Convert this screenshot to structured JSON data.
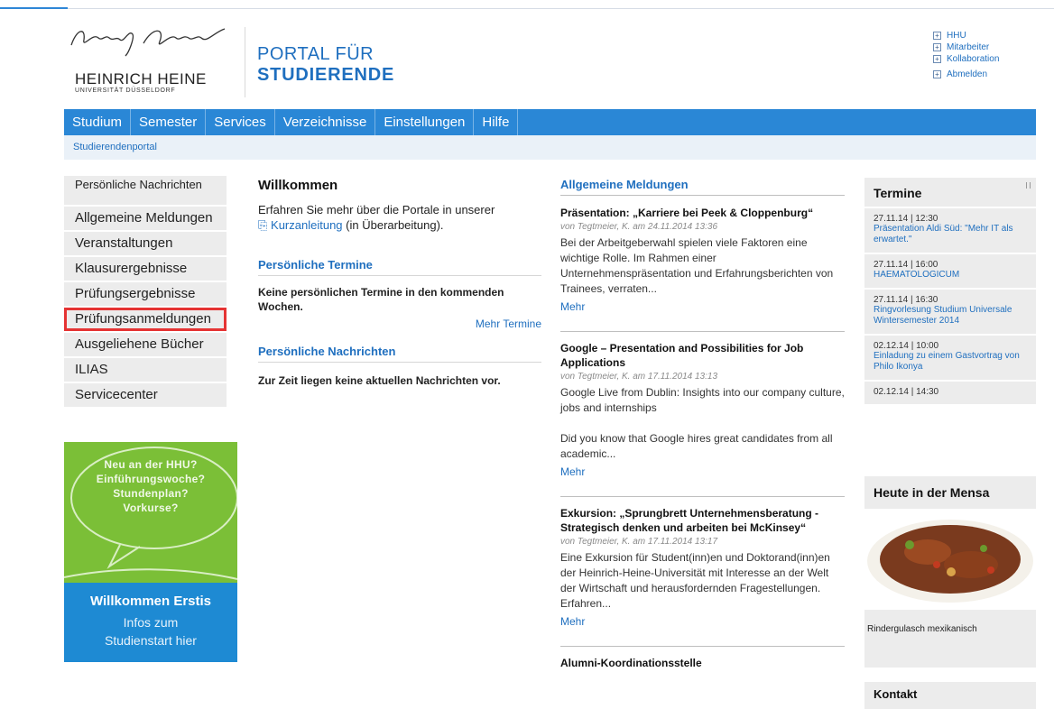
{
  "header": {
    "logo_name": "HEINRICH HEINE",
    "logo_sub": "UNIVERSITÄT DÜSSELDORF",
    "portal_line1": "PORTAL FÜR",
    "portal_line2": "STUDIERENDE",
    "top_links": [
      "HHU",
      "Mitarbeiter",
      "Kollaboration",
      "Abmelden"
    ]
  },
  "nav": [
    "Studium",
    "Semester",
    "Services",
    "Verzeichnisse",
    "Einstellungen",
    "Hilfe"
  ],
  "breadcrumb": "Studierendenportal",
  "sidebar": {
    "items": [
      "Persönliche Nachrichten",
      "Allgemeine Meldungen",
      "Veranstaltungen",
      "Klausurergebnisse",
      "Prüfungsergebnisse",
      "Prüfungsanmeldungen",
      "Ausgeliehene Bücher",
      "ILIAS",
      "Servicecenter"
    ],
    "active_index": 5
  },
  "banner": {
    "lines": [
      "Neu an der HHU?",
      "Einführungswoche?",
      "Stundenplan?",
      "Vorkurse?"
    ],
    "title": "Willkommen Erstis",
    "sub1": "Infos zum",
    "sub2": "Studienstart hier",
    "green": "#7bbf37",
    "blue": "#1e8ad3"
  },
  "welcome": {
    "title": "Willkommen",
    "text_pre": "Erfahren Sie mehr über die Portale in unserer",
    "link": "Kurzanleitung",
    "text_post": "(in Überarbeitung)."
  },
  "termine_personal": {
    "title": "Persönliche Termine",
    "empty": "Keine persönlichen Termine in den kommenden Wochen.",
    "more": "Mehr Termine"
  },
  "nachrichten_personal": {
    "title": "Persönliche Nachrichten",
    "empty": "Zur Zeit liegen keine aktuellen Nachrichten vor."
  },
  "news": {
    "title": "Allgemeine Meldungen",
    "items": [
      {
        "title": "Präsentation: „Karriere bei Peek & Cloppenburg“",
        "meta": "von Tegtmeier, K. am 24.11.2014 13:36",
        "body": "Bei der Arbeitgeberwahl spielen viele Faktoren eine wichtige Rolle. Im Rahmen einer Unternehmenspräsentation und Erfahrungsberichten von Trainees, verraten...",
        "more": "Mehr"
      },
      {
        "title": "Google – Presentation and Possibilities for Job Applications",
        "meta": "von Tegtmeier, K. am 17.11.2014 13:13",
        "body": "Google Live from Dublin: Insights into our company culture, jobs and internships",
        "body2": "Did you know that Google hires great candidates from all academic...",
        "more": "Mehr"
      },
      {
        "title": "Exkursion: „Sprungbrett Unternehmensberatung - Strategisch denken und arbeiten bei McKinsey“",
        "meta": "von Tegtmeier, K. am 17.11.2014 13:17",
        "body": "Eine Exkursion für Student(inn)en und Doktorand(inn)en der Heinrich-Heine-Universität mit Interesse an der Welt der Wirtschaft und herausfordernden Fragestellungen. Erfahren...",
        "more": "Mehr"
      }
    ],
    "next_title": "Alumni-Koordinationsstelle"
  },
  "termine": {
    "title": "Termine",
    "events": [
      {
        "date": "27.11.14 | 12:30",
        "title": "Präsentation Aldi Süd: \"Mehr IT als erwartet.\""
      },
      {
        "date": "27.11.14 | 16:00",
        "title": "HAEMATOLOGICUM"
      },
      {
        "date": "27.11.14 | 16:30",
        "title": "Ringvorlesung Studium Universale Wintersemester 2014"
      },
      {
        "date": "02.12.14 | 10:00",
        "title": "Einladung zu einem Gastvortrag von Philo Ikonya"
      },
      {
        "date": "02.12.14 | 14:30",
        "title": ""
      }
    ]
  },
  "mensa": {
    "title": "Heute in der Mensa",
    "dish": "Rindergulasch mexikanisch"
  },
  "kontakt": {
    "title": "Kontakt"
  }
}
